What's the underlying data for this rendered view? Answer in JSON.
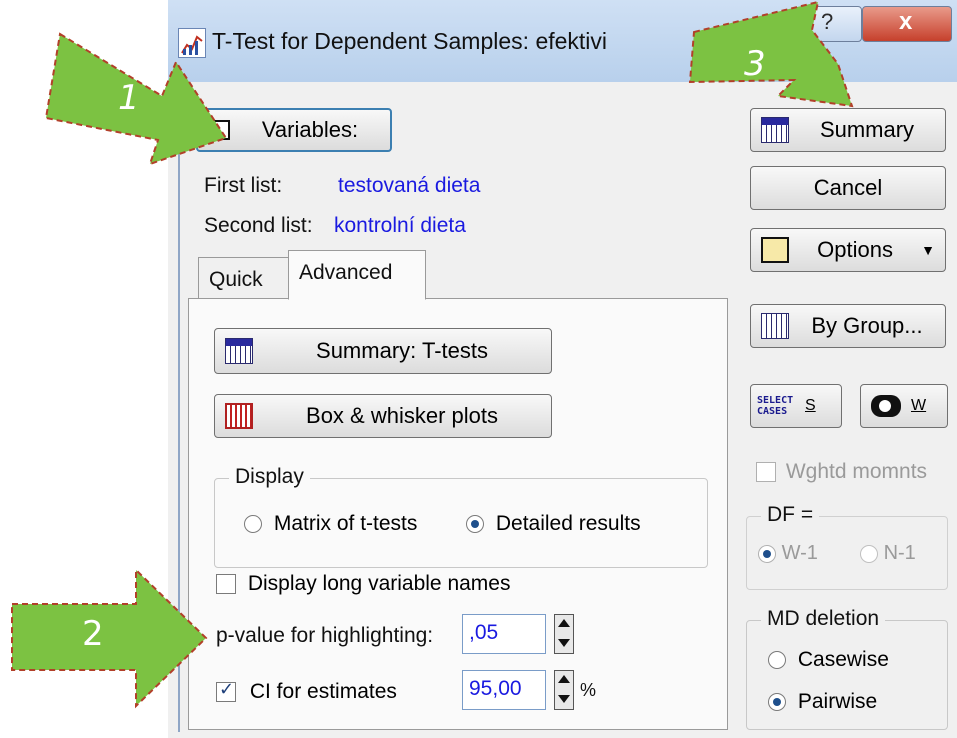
{
  "window": {
    "title": "T-Test for Dependent Samples: efektivi"
  },
  "titlebar_buttons": {
    "help": "?",
    "close": "x"
  },
  "variables": {
    "button_label": "Variables:",
    "first_list_label": "First list:",
    "first_list_value": "testovaná dieta",
    "second_list_label": "Second list:",
    "second_list_value": "kontrolní dieta"
  },
  "tabs": [
    {
      "label": "Quick"
    },
    {
      "label": "Advanced"
    }
  ],
  "advanced": {
    "summary_ttests_label": "Summary:  T-tests",
    "box_whisker_label": "Box & whisker plots",
    "display_group_label": "Display",
    "display_options": [
      {
        "label": "Matrix of t-tests",
        "selected": false
      },
      {
        "label": "Detailed results",
        "selected": true
      }
    ],
    "long_names_label": "Display long variable names",
    "long_names_checked": false,
    "pvalue_label": "p-value for highlighting:",
    "pvalue_value": ",05",
    "ci_label": "CI for estimates",
    "ci_checked": true,
    "ci_value": "95,00",
    "ci_unit": "%"
  },
  "right_buttons": {
    "summary": "Summary",
    "cancel": "Cancel",
    "options": "Options",
    "by_group": "By Group...",
    "select_cases_icon_text": "SELECT CASES",
    "select_cases_key": "S",
    "weight_key": "W"
  },
  "weighted_moments": {
    "label": "Wghtd momnts",
    "checked": false
  },
  "df": {
    "label": "DF =",
    "options": [
      {
        "label": "W-1",
        "selected": true
      },
      {
        "label": "N-1",
        "selected": false
      }
    ]
  },
  "md_deletion": {
    "label": "MD deletion",
    "options": [
      {
        "label": "Casewise",
        "selected": false
      },
      {
        "label": "Pairwise",
        "selected": true
      }
    ]
  },
  "annotations": [
    {
      "label": "1"
    },
    {
      "label": "2"
    },
    {
      "label": "3"
    }
  ],
  "colors": {
    "accent_green": "#7cc242",
    "arrow_border": "#b2402a",
    "value_blue": "#1a1ae0"
  }
}
